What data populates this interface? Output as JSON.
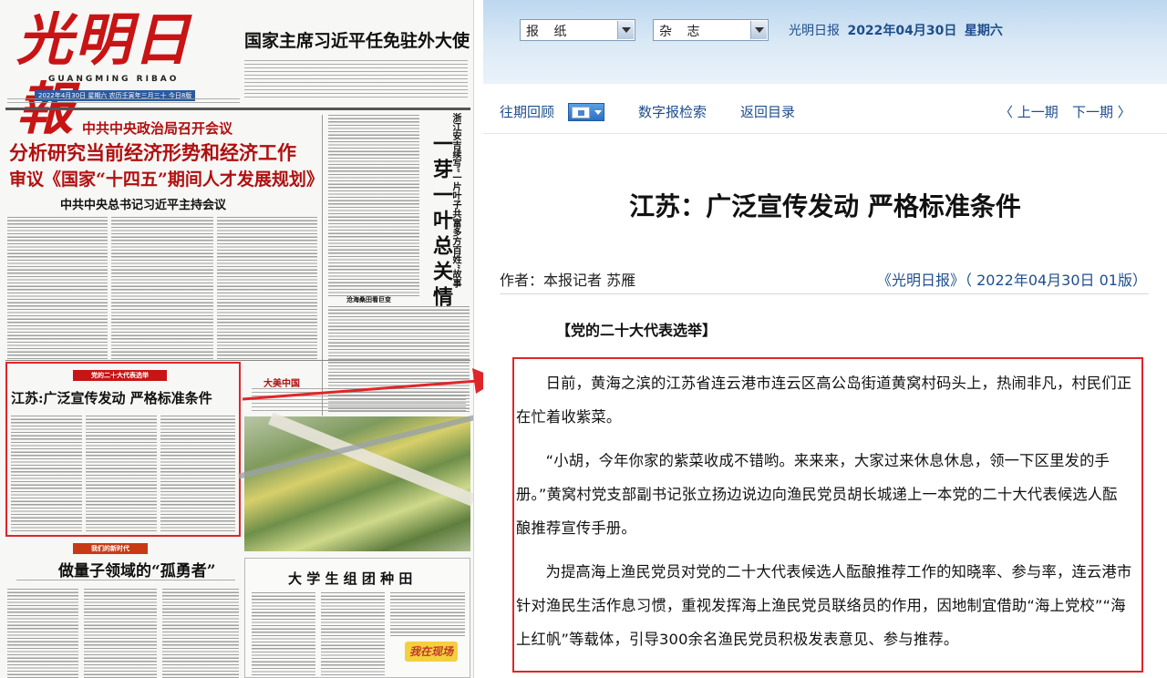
{
  "paper": {
    "logo": "光明日報",
    "logo_en": "GUANGMING RIBAO",
    "date_strip": "2022年4月30日 星期六 农历壬寅年三月三十 今日8版",
    "lead_headline": "国家主席习近平任免驻外大使",
    "politburo_kicker": "中共中央政治局召开会议",
    "politburo_head1": "分析研究当前经济形势和经济工作",
    "politburo_head2": "审议《国家“十四五”期间人才发展规划》",
    "politburo_sub": "中共中央总书记习近平主持会议",
    "vertical_kicker": "浙江安吉续写“一片叶子共富多方百姓”故事",
    "vertical_head": "一芽一叶总关情",
    "column_badge": "党的二十大代表选举",
    "highlight_head": "江苏:广泛宣传发动 严格标准条件",
    "section_badge": "我们的新时代",
    "quantum_head": "做量子领域的“孤勇者”",
    "photo_label": "大美中国",
    "students_head": "大 学 生 组 团 种 田",
    "mini_logo": "我在现场",
    "inner_section": "沧海桑田看巨变"
  },
  "reader": {
    "select_paper": "报 纸",
    "select_magazine": "杂 志",
    "paper_name": "光明日报",
    "issue_date": "2022年04月30日",
    "weekday": "星期六",
    "nav": {
      "archive": "往期回顾",
      "search": "数字报检索",
      "toc": "返回目录",
      "prev": "〈 上一期",
      "next": "下一期 〉"
    },
    "article": {
      "title": "江苏：广泛宣传发动 严格标准条件",
      "byline": "作者：本报记者 苏雁",
      "source": "《光明日报》（ 2022年04月30日 01版）",
      "column": "【党的二十大代表选举】",
      "paragraphs": [
        "日前，黄海之滨的江苏省连云港市连云区高公岛街道黄窝村码头上，热闹非凡，村民们正在忙着收紫菜。",
        "“小胡，今年你家的紫菜收成不错哟。来来来，大家过来休息休息，领一下区里发的手册。”黄窝村党支部副书记张立扬边说边向渔民党员胡长城递上一本党的二十大代表候选人酝酿推荐宣传手册。",
        "为提高海上渔民党员对党的二十大代表候选人酝酿推荐工作的知晓率、参与率，连云港市针对渔民生活作息习惯，重视发挥海上渔民党员联络员的作用，因地制宜借助“海上党校”“海上红帆”等载体，引导300余名渔民党员积极发表意见、参与推荐。"
      ]
    }
  },
  "colors": {
    "highlight_red": "#e0252a",
    "masthead_red": "#c81414",
    "link_blue": "#1f4e8c",
    "topbar_blue": "#bcd7ef"
  }
}
